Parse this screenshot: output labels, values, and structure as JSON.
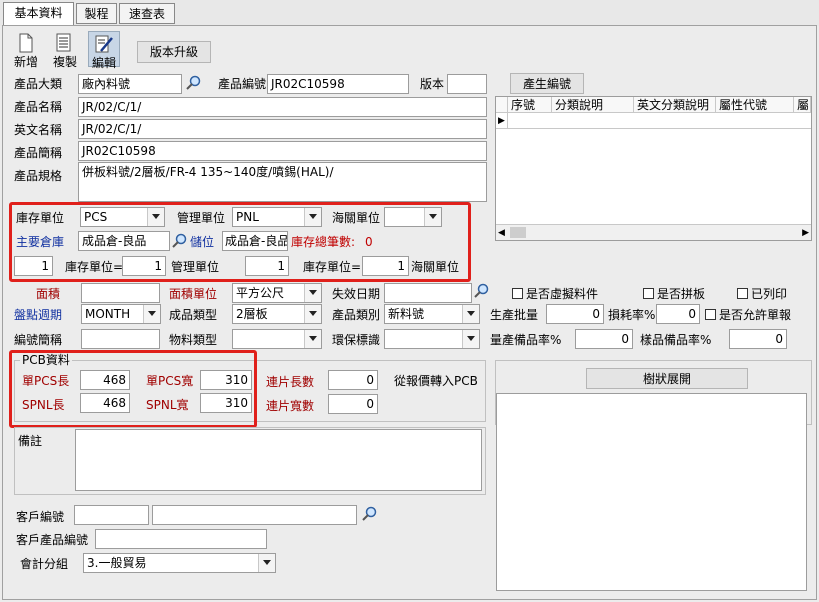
{
  "tabs": [
    "基本資料",
    "製程",
    "速查表"
  ],
  "toolbar": {
    "new": "新增",
    "copy": "複製",
    "edit": "編輯",
    "upgrade": "版本升級"
  },
  "product": {
    "category_label": "產品大類",
    "category_value": "廠內料號",
    "code_label": "產品編號",
    "code_value": "JR02C10598",
    "version_label": "版本",
    "version_value": "",
    "gen_code_btn": "產生編號",
    "name_label": "產品名稱",
    "name_value": "JR/02/C/1/",
    "en_label": "英文名稱",
    "en_value": "JR/02/C/1/",
    "short_label": "產品簡稱",
    "short_value": "JR02C10598",
    "spec_label": "產品規格",
    "spec_value": "併板料號/2層板/FR-4 135~140度/噴錫(HAL)/"
  },
  "classify_grid": {
    "headers": [
      "序號",
      "分類說明",
      "英文分類說明",
      "屬性代號",
      "屬"
    ],
    "row_marker": "▶"
  },
  "units": {
    "stock_unit_label": "庫存單位",
    "stock_unit_value": "PCS",
    "mgmt_unit_label": "管理單位",
    "mgmt_unit_value": "PNL",
    "customs_unit_label": "海關單位",
    "customs_unit_value": "",
    "main_wh_label": "主要倉庫",
    "main_wh_value": "成品倉-良品",
    "bin_label": "儲位",
    "bin_value": "成品倉-良品",
    "stock_total_label": "庫存總筆數:",
    "stock_total_value": "0",
    "qty1": "1",
    "conv1_label": "庫存單位=",
    "qty2": "1",
    "conv1_unit": "管理單位",
    "qty3": "1",
    "conv2_label": "庫存單位=",
    "qty4": "1",
    "conv2_unit": "海關單位"
  },
  "misc": {
    "area_label": "面積",
    "area_value": "",
    "area_unit_label": "面積單位",
    "area_unit_value": "平方公尺",
    "expire_label": "失效日期",
    "expire_value": "",
    "virtual_label": "是否虛擬料件",
    "panel_label": "是否拼板",
    "printed_label": "已列印",
    "cycle_label": "盤點週期",
    "cycle_value": "MONTH",
    "fg_type_label": "成品類型",
    "fg_type_value": "2層板",
    "prod_cat_label": "產品類別",
    "prod_cat_value": "新料號",
    "batch_label": "生產批量",
    "batch_value": "0",
    "loss_label": "損耗率%",
    "loss_value": "0",
    "allow_label": "是否允許單報",
    "code_short_label": "編號簡稱",
    "code_short_value": "",
    "mat_type_label": "物料類型",
    "mat_type_value": "",
    "env_label": "環保標識",
    "env_value": "",
    "spare_label": "量產備品率%",
    "spare_value": "0",
    "sample_label": "樣品備品率%",
    "sample_value": "0"
  },
  "pcb": {
    "title": "PCB資料",
    "pcs_len_label": "單PCS長",
    "pcs_len_value": "468",
    "pcs_wid_label": "單PCS寬",
    "pcs_wid_value": "310",
    "pnl_len_label": "SPNL長",
    "pnl_len_value": "468",
    "pnl_wid_label": "SPNL寬",
    "pnl_wid_value": "310",
    "link_len_label": "連片長數",
    "link_len_value": "0",
    "link_wid_label": "連片寬數",
    "link_wid_value": "0",
    "convert_label": "從報價轉入PCB"
  },
  "tree_btn": "樹狀展開",
  "remark_label": "備註",
  "remark_value": "",
  "customer": {
    "code_label": "客戶編號",
    "code_value": "",
    "name_value": "",
    "prod_code_label": "客戶產品編號",
    "prod_code_value": "",
    "acct_label": "會計分組",
    "acct_value": "3.一般貿易"
  }
}
